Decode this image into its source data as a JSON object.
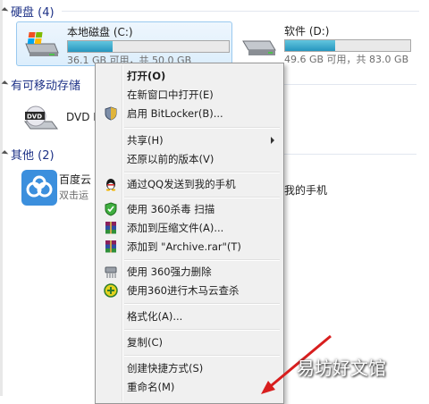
{
  "groups": {
    "hard_disks": "硬盘 (4)",
    "removable": "有可移动存储",
    "other": "其他 (2)"
  },
  "drives": [
    {
      "name": "本地磁盘 (C:)",
      "space": "36.1 GB 可用，共 50.0 GB",
      "used_fraction": 0.28
    },
    {
      "name": "软件 (D:)",
      "space": "49.6 GB 可用，共 83.0 GB",
      "used_fraction": 0.4
    }
  ],
  "dvd": {
    "name": "DVD R"
  },
  "baidu": {
    "name": "百度云",
    "sub": "双击运",
    "trail_text": "我的手机"
  },
  "context_menu": {
    "items": [
      {
        "label": "打开(O)",
        "icon": ""
      },
      {
        "label": "在新窗口中打开(E)",
        "icon": ""
      },
      {
        "label": "启用 BitLocker(B)...",
        "icon": "bitlocker-shield-icon"
      },
      {
        "label": "共享(H)",
        "icon": ""
      },
      {
        "label": "还原以前的版本(V)",
        "icon": ""
      },
      {
        "label": "通过QQ发送到我的手机",
        "icon": "qq-penguin-icon"
      },
      {
        "label": "使用 360杀毒 扫描",
        "icon": "360-antivirus-icon"
      },
      {
        "label": "添加到压缩文件(A)...",
        "icon": "winrar-icon"
      },
      {
        "label": "添加到 \"Archive.rar\"(T)",
        "icon": "winrar-icon"
      },
      {
        "label": "使用 360强力删除",
        "icon": "360-shredder-icon"
      },
      {
        "label": "使用360进行木马云查杀",
        "icon": "360-trojan-scan-icon"
      },
      {
        "label": "格式化(A)...",
        "icon": ""
      },
      {
        "label": "复制(C)",
        "icon": ""
      },
      {
        "label": "创建快捷方式(S)",
        "icon": ""
      },
      {
        "label": "重命名(M)",
        "icon": ""
      }
    ]
  },
  "watermark": "易坊好文馆",
  "colors": {
    "group_header": "#1e3287",
    "selection": "#dceefc",
    "bar_fill": "#2696bf",
    "menu_bg": "#f0f0f0"
  }
}
